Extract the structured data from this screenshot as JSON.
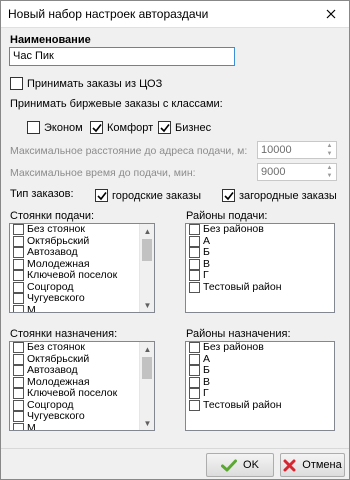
{
  "window": {
    "title": "Новый набор настроек автораздачи"
  },
  "name": {
    "label": "Наименование",
    "value": "Час Пик"
  },
  "accept_cos": {
    "label": "Принимать заказы из ЦОЗ",
    "checked": false
  },
  "exchange": {
    "label": "Принимать биржевые заказы с классами:",
    "classes": [
      {
        "label": "Эконом",
        "checked": false
      },
      {
        "label": "Комфорт",
        "checked": true
      },
      {
        "label": "Бизнес",
        "checked": true
      }
    ]
  },
  "max_distance": {
    "label": "Максимальное расстояние до адреса подачи, м:",
    "value": "10000"
  },
  "max_time": {
    "label": "Максимальное время до подачи, мин:",
    "value": "9000"
  },
  "order_type": {
    "label": "Тип заказов:",
    "city": {
      "label": "городские заказы",
      "checked": true
    },
    "suburban": {
      "label": "загородные заказы",
      "checked": true
    }
  },
  "pickup_stands": {
    "label": "Стоянки подачи:",
    "items": [
      "Без стоянок",
      "Октябрьский",
      "Автозавод",
      "Молодежная",
      "Ключевой поселок",
      "Соцгород",
      "Чугуевского",
      "М"
    ]
  },
  "pickup_districts": {
    "label": "Районы подачи:",
    "items": [
      "Без районов",
      "А",
      "Б",
      "В",
      "Г",
      "Тестовый район"
    ]
  },
  "dest_stands": {
    "label": "Стоянки назначения:",
    "items": [
      "Без стоянок",
      "Октябрьский",
      "Автозавод",
      "Молодежная",
      "Ключевой поселок",
      "Соцгород",
      "Чугуевского",
      "М"
    ]
  },
  "dest_districts": {
    "label": "Районы назначения:",
    "items": [
      "Без районов",
      "А",
      "Б",
      "В",
      "Г",
      "Тестовый район"
    ]
  },
  "buttons": {
    "ok": "OK",
    "cancel": "Отмена"
  },
  "colors": {
    "ok_icon": "#5aa832",
    "cancel_icon": "#d8242f",
    "focus_border": "#3c8fd6"
  }
}
